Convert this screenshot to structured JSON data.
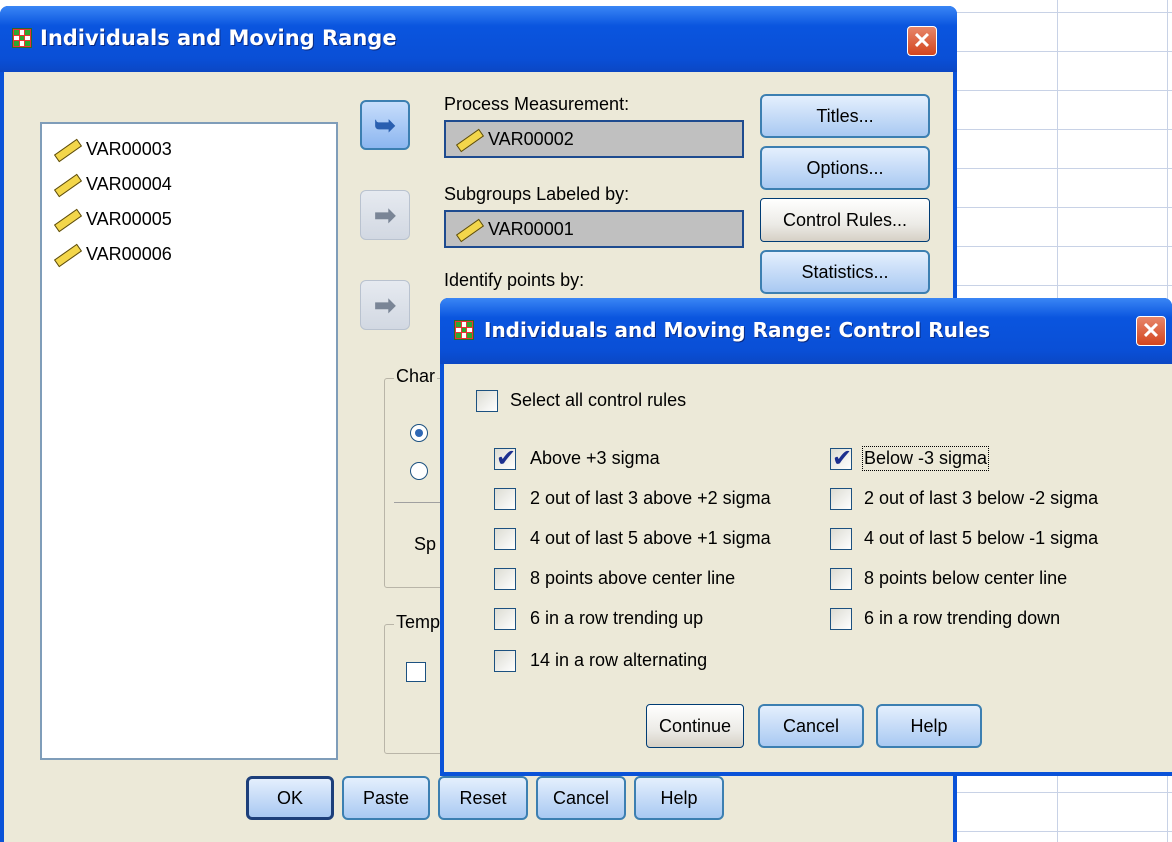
{
  "main_window": {
    "title": "Individuals and Moving Range",
    "variables": [
      "VAR00003",
      "VAR00004",
      "VAR00005",
      "VAR00006"
    ],
    "process_measurement": {
      "label": "Process Measurement:",
      "value": "VAR00002"
    },
    "subgroups": {
      "label": "Subgroups Labeled by:",
      "value": "VAR00001"
    },
    "identify_points_label": "Identify points by:",
    "side_buttons": [
      "Titles...",
      "Options...",
      "Control Rules...",
      "Statistics..."
    ],
    "charts_group_label": "Char",
    "spec_label": "Sp",
    "template_group_label": "Temp",
    "bottom_buttons": [
      "OK",
      "Paste",
      "Reset",
      "Cancel",
      "Help"
    ]
  },
  "dialog": {
    "title": "Individuals and Moving Range: Control Rules",
    "select_all": {
      "label": "Select all control rules",
      "checked": false
    },
    "left_rules": [
      {
        "label": "Above +3 sigma",
        "checked": true
      },
      {
        "label": "2 out of last 3 above +2 sigma",
        "checked": false
      },
      {
        "label": "4 out of last 5 above +1 sigma",
        "checked": false
      },
      {
        "label": "8 points above center line",
        "checked": false
      },
      {
        "label": "6 in a row trending up",
        "checked": false
      },
      {
        "label": "14 in a row alternating",
        "checked": false
      }
    ],
    "right_rules": [
      {
        "label": "Below -3 sigma",
        "checked": true
      },
      {
        "label": "2 out of last 3 below -2 sigma",
        "checked": false
      },
      {
        "label": "4 out of last 5 below -1 sigma",
        "checked": false
      },
      {
        "label": "8 points below center line",
        "checked": false
      },
      {
        "label": "6 in a row trending down",
        "checked": false
      }
    ],
    "buttons": [
      "Continue",
      "Cancel",
      "Help"
    ]
  },
  "colors": {
    "titlebar": "#0a52d8",
    "face": "#ece9d8",
    "close": "#d3451e"
  }
}
